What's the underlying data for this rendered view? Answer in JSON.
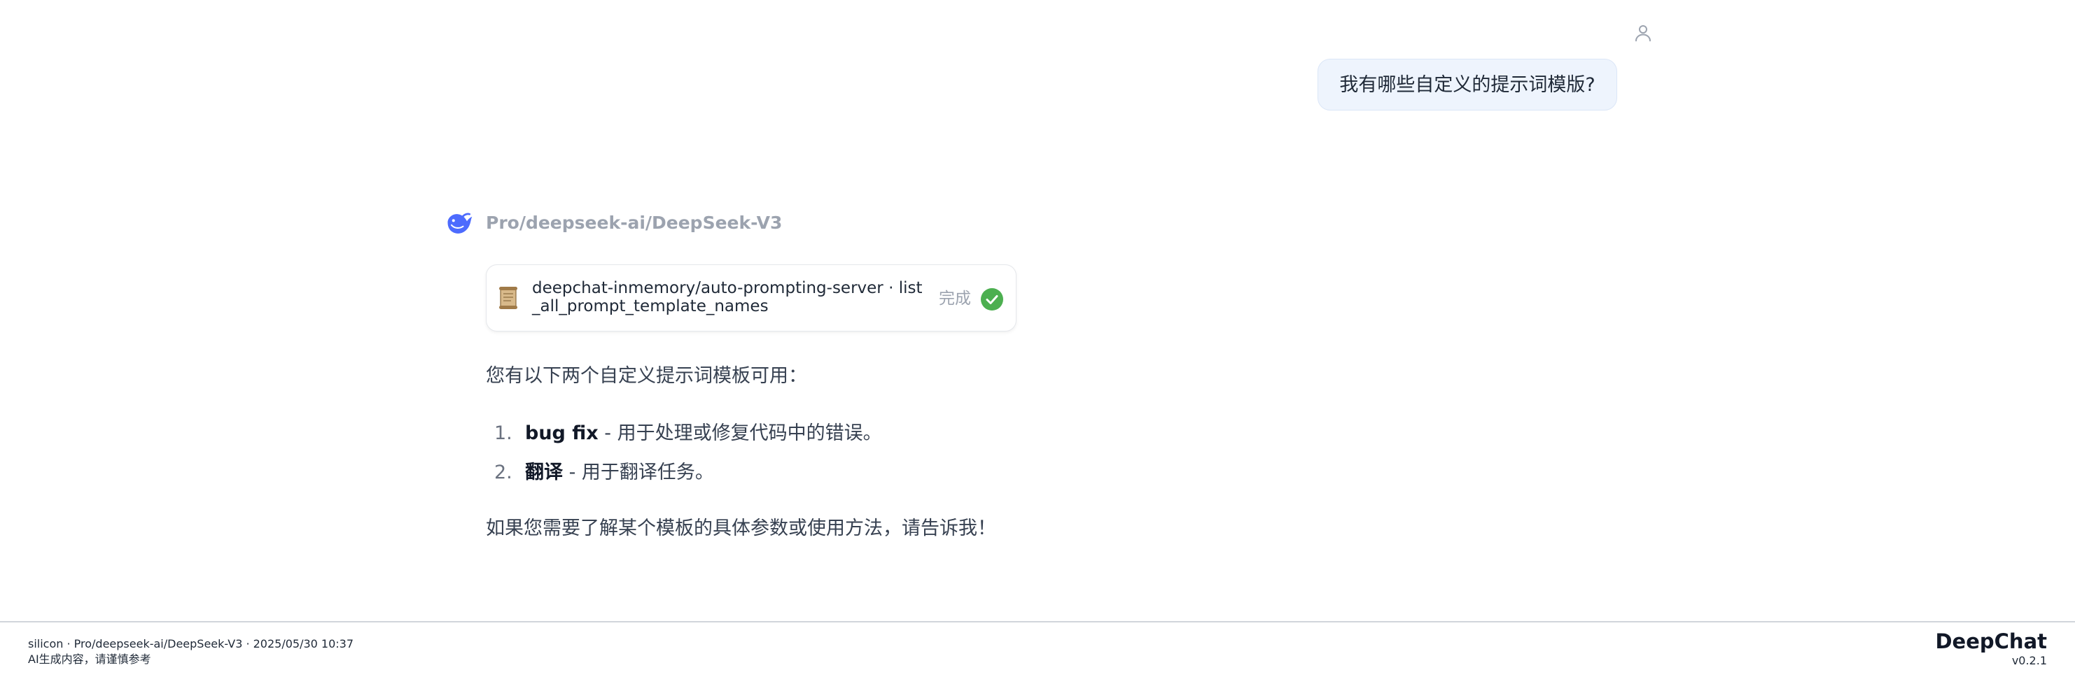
{
  "user_message": {
    "text": "我有哪些自定义的提示词模版?",
    "avatar_icon": "user-icon"
  },
  "assistant": {
    "logo_icon": "deepseek-whale-icon",
    "model_name": "Pro/deepseek-ai/DeepSeek-V3",
    "tool_call": {
      "icon": "scroll-icon",
      "name": "deepchat-inmemory/auto-prompting-server · list_all_prompt_template_names",
      "status": "完成",
      "status_icon": "check-circle-icon",
      "status_color": "#4caf50"
    },
    "intro": "您有以下两个自定义提示词模板可用：",
    "items": [
      {
        "number": "1.",
        "term": "bug fix",
        "description": " - 用于处理或修复代码中的错误。"
      },
      {
        "number": "2.",
        "term": "翻译",
        "description": " - 用于翻译任务。"
      }
    ],
    "outro": "如果您需要了解某个模板的具体参数或使用方法，请告诉我！"
  },
  "footer": {
    "meta": "silicon · Pro/deepseek-ai/DeepSeek-V3 · 2025/05/30 10:37",
    "disclaimer": "AI生成内容，请谨慎参考",
    "brand": "DeepChat",
    "version": "v0.2.1"
  },
  "colors": {
    "user_bubble_bg": "#eef4fd",
    "model_name": "#9ca3af",
    "brand_blue": "#4d6bfe"
  }
}
